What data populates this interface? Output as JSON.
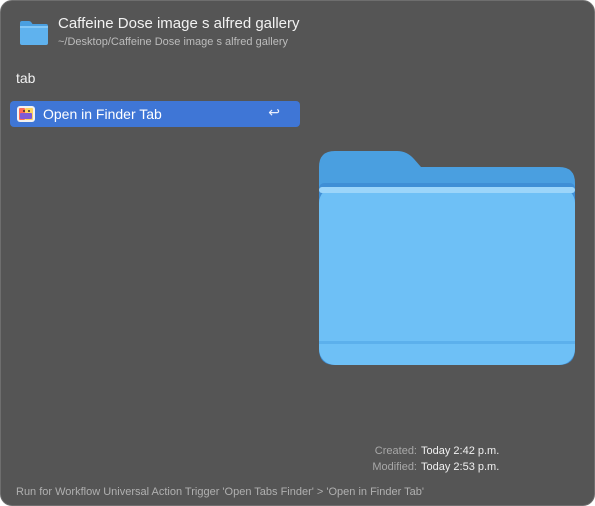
{
  "header": {
    "icon": "folder-icon",
    "title": "Caffeine Dose image s alfred gallery",
    "path": "~/Desktop/Caffeine Dose image s alfred gallery"
  },
  "query": "tab",
  "results": [
    {
      "icon": "finder-icon",
      "label": "Open in Finder Tab",
      "shortcut": "↩",
      "selected": true
    }
  ],
  "preview": {
    "icon": "folder-preview-icon"
  },
  "meta": {
    "created_label": "Created:",
    "created_value": "Today 2:42 p.m.",
    "modified_label": "Modified:",
    "modified_value": "Today 2:53 p.m."
  },
  "footer": "Run for Workflow Universal Action Trigger 'Open Tabs Finder' > 'Open in Finder Tab'",
  "colors": {
    "window_bg": "#555555",
    "selection": "#3f76d6",
    "folder_blue": "#6fbff5"
  }
}
